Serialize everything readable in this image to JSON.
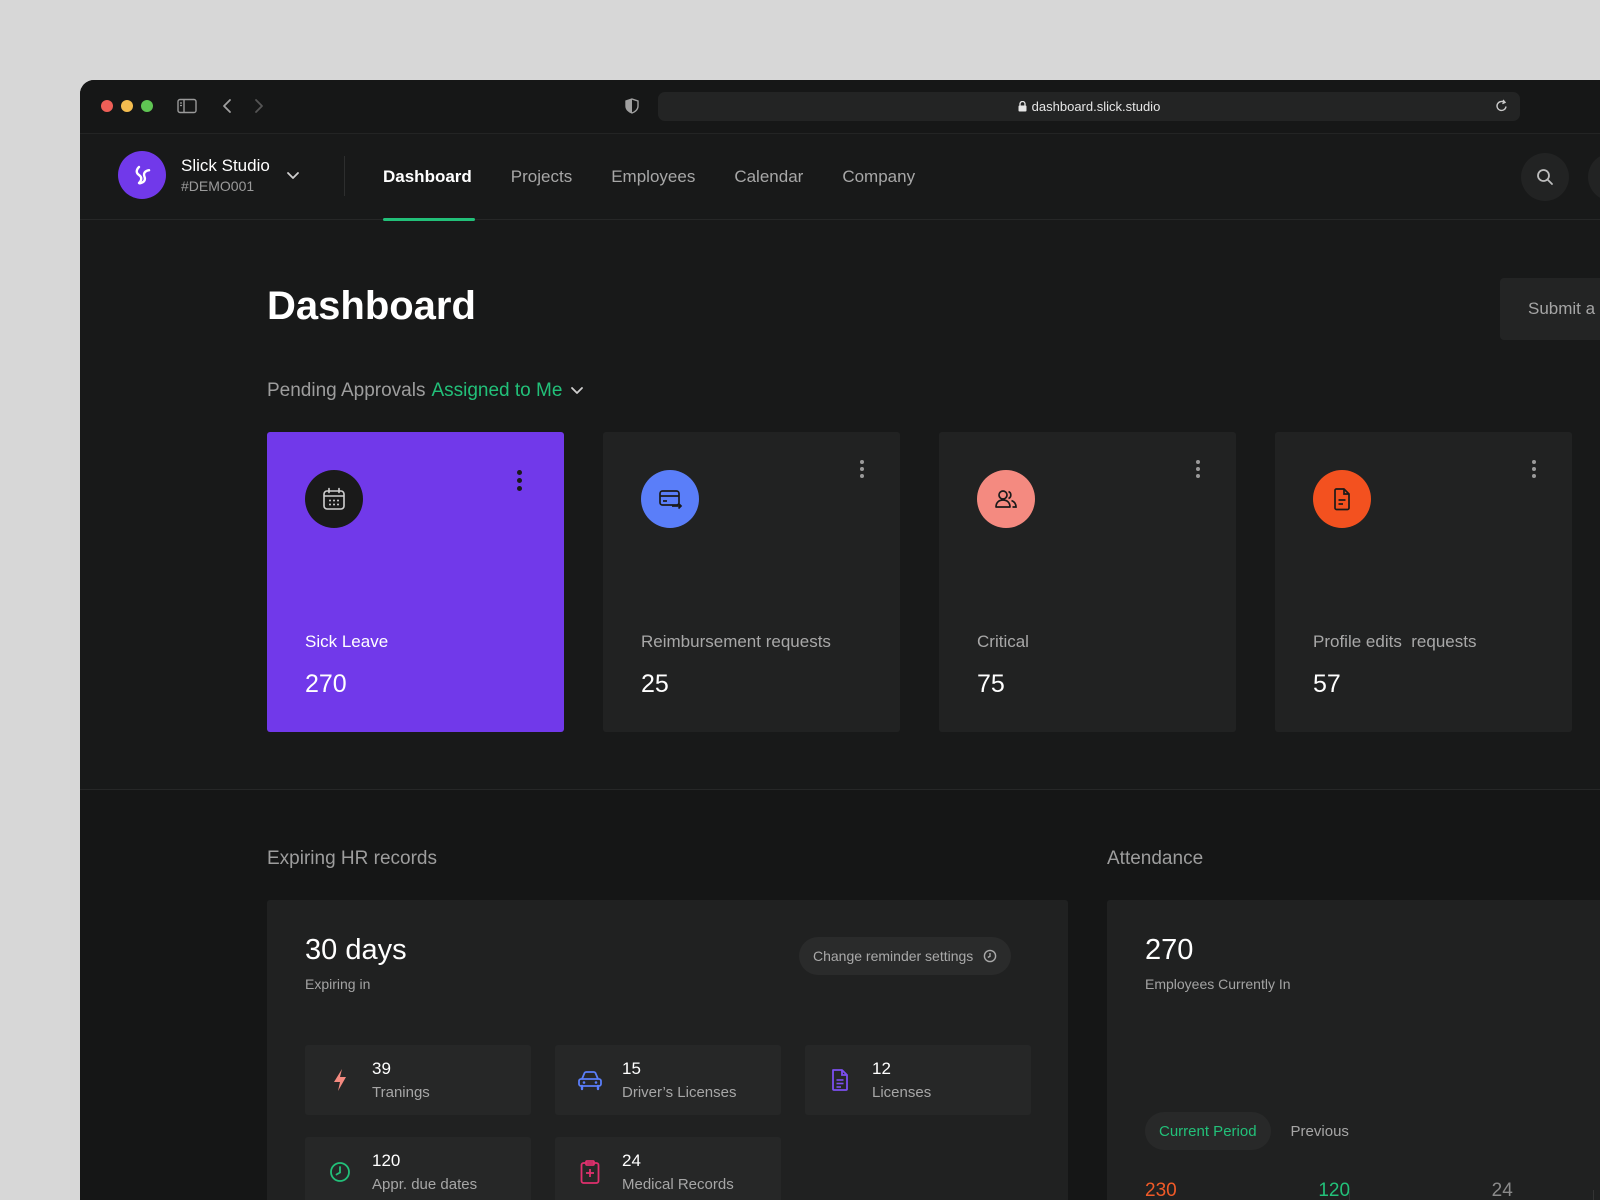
{
  "browser": {
    "url": "dashboard.slick.studio"
  },
  "brand": {
    "name": "Slick Studio",
    "code": "#DEMO001"
  },
  "nav": {
    "tabs": [
      {
        "label": "Dashboard",
        "active": true
      },
      {
        "label": "Projects",
        "active": false
      },
      {
        "label": "Employees",
        "active": false
      },
      {
        "label": "Calendar",
        "active": false
      },
      {
        "label": "Company",
        "active": false
      }
    ]
  },
  "page": {
    "title": "Dashboard",
    "submit_label": "Submit a"
  },
  "approvals": {
    "heading": "Pending Approvals",
    "filter": "Assigned to Me",
    "cards": [
      {
        "label": "Sick Leave",
        "value": "270",
        "icon": "calendar-icon",
        "color": "#1a1a1a"
      },
      {
        "label": "Reimbursement requests",
        "value": "25",
        "icon": "card-transfer-icon",
        "color": "#5a7ef9"
      },
      {
        "label": "Critical",
        "value": "75",
        "icon": "users-icon",
        "color": "#f48a80"
      },
      {
        "label": "Profile edits  requests",
        "value": "57",
        "icon": "document-icon",
        "color": "#f3511f"
      }
    ]
  },
  "hr_records": {
    "title": "Expiring HR records",
    "days": "30 days",
    "days_sub": "Expiring in",
    "reminder_label": "Change reminder settings",
    "records": [
      {
        "count": "39",
        "label": "Tranings",
        "icon": "bolt-icon",
        "color": "#f48a80"
      },
      {
        "count": "15",
        "label": "Driver’s Licenses",
        "icon": "car-icon",
        "color": "#5a7ef9"
      },
      {
        "count": "12",
        "label": "Licenses",
        "icon": "file-icon",
        "color": "#7c4ff0"
      },
      {
        "count": "120",
        "label": "Appr. due dates",
        "icon": "clock-icon",
        "color": "#22c079"
      },
      {
        "count": "24",
        "label": "Medical Records",
        "icon": "medical-icon",
        "color": "#e0306e"
      }
    ]
  },
  "attendance": {
    "title": "Attendance",
    "count": "270",
    "count_sub": "Employees Currently In",
    "periods": [
      {
        "label": "Current Period",
        "active": true
      },
      {
        "label": "Previous",
        "active": false
      }
    ],
    "stats": [
      "230",
      "120",
      "24"
    ]
  },
  "colors": {
    "accent": "#22c079",
    "primary_card": "#7139ea"
  }
}
